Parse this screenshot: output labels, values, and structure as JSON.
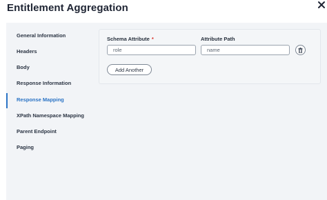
{
  "dialog": {
    "title": "Entitlement Aggregation",
    "close_icon": "close-icon"
  },
  "nav": {
    "items": [
      {
        "label": "General Information",
        "active": false
      },
      {
        "label": "Headers",
        "active": false
      },
      {
        "label": "Body",
        "active": false
      },
      {
        "label": "Response Information",
        "active": false
      },
      {
        "label": "Response Mapping",
        "active": true
      },
      {
        "label": "XPath Namespace Mapping",
        "active": false
      },
      {
        "label": "Parent Endpoint",
        "active": false
      },
      {
        "label": "Paging",
        "active": false
      }
    ]
  },
  "mapping": {
    "schema_attribute_label": "Schema Attribute",
    "required_marker": "*",
    "attribute_path_label": "Attribute Path",
    "rows": [
      {
        "schema_attribute": "role",
        "attribute_path": "name"
      }
    ],
    "delete_icon": "trash-icon",
    "add_button_label": "Add Another"
  },
  "colors": {
    "accent": "#2a73c5",
    "required": "#d93025",
    "panel_background": "#f2f4f7"
  }
}
